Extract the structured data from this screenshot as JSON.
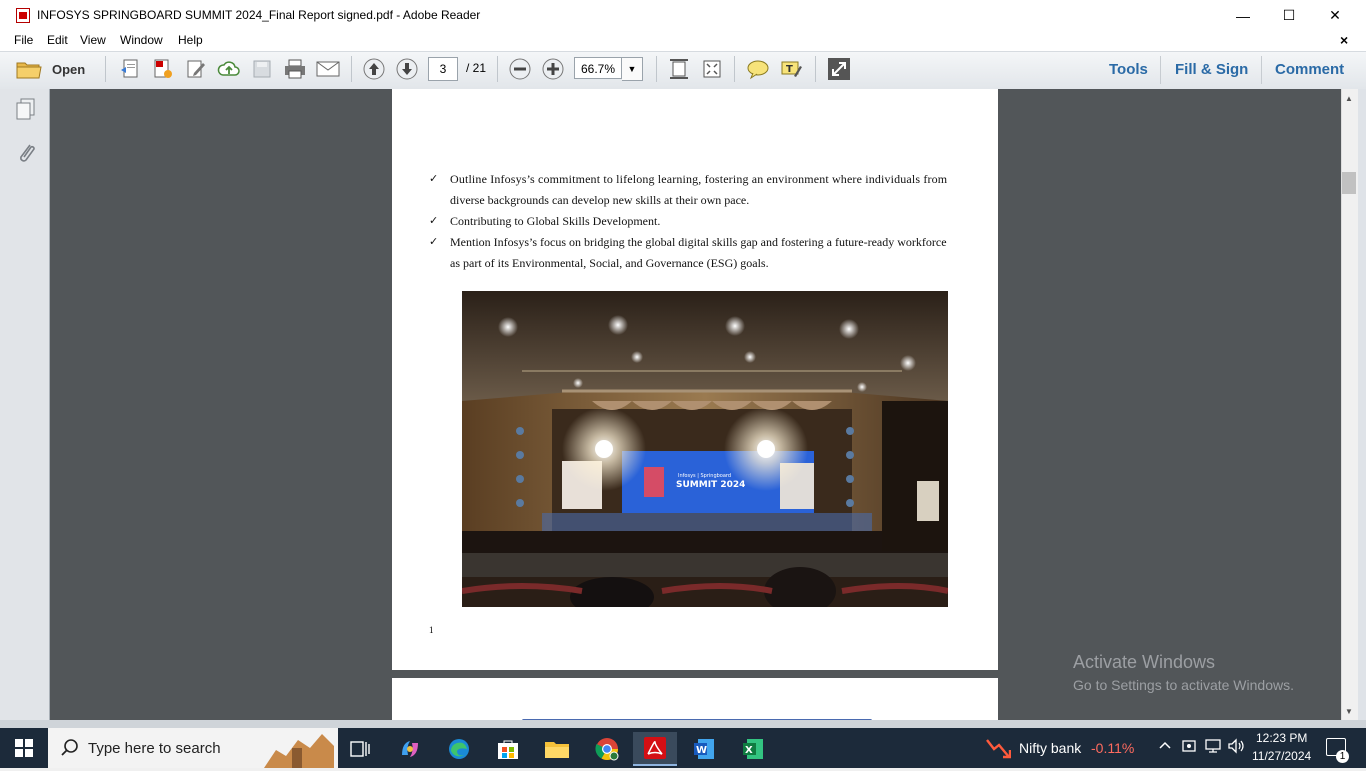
{
  "window": {
    "title": "INFOSYS SPRINGBOARD SUMMIT 2024_Final Report signed.pdf - Adobe Reader",
    "minimize": "—",
    "maximize": "☐",
    "close": "✕"
  },
  "menu": {
    "items": [
      "File",
      "Edit",
      "View",
      "Window",
      "Help"
    ],
    "close_doc": "×"
  },
  "toolbar": {
    "open_label": "Open",
    "current_page": "3",
    "page_total": "/ 21",
    "zoom": "66.7%",
    "tools_label": "Tools",
    "fill_sign_label": "Fill & Sign",
    "comment_label": "Comment"
  },
  "document": {
    "lines": [
      "Outline Infosys’s commitment to lifelong learning, fostering an environment where individuals from",
      "diverse backgrounds can develop new skills at their own pace.",
      "Contributing to Global Skills Development.",
      "Mention Infosys’s focus on bridging the global digital skills gap and fostering a future-ready workforce",
      "as part of its Environmental, Social, and Governance (ESG) goals."
    ],
    "check_mark": "✓",
    "stage_screen_text": "SUMMIT 2024",
    "stage_screen_small": "Infosys | Springboard",
    "page_number": "1"
  },
  "watermark": {
    "title": "Activate Windows",
    "subtitle": "Go to Settings to activate Windows."
  },
  "taskbar": {
    "search_placeholder": "Type here to search",
    "stock_name": "Nifty bank",
    "stock_change": "-0.11%",
    "time": "12:23 PM",
    "date": "11/27/2024",
    "notification_count": "1"
  }
}
